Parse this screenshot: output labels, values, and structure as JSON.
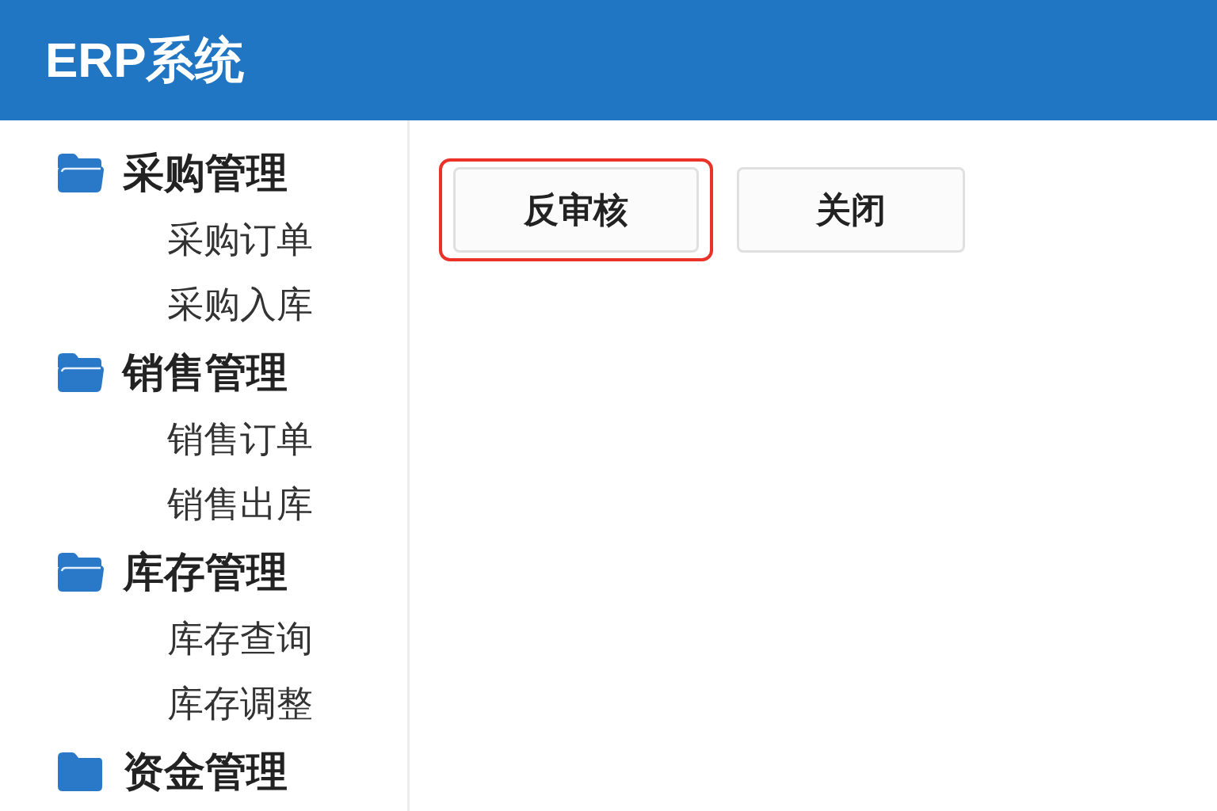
{
  "header": {
    "title": "ERP系统"
  },
  "sidebar": {
    "items": [
      {
        "label": "采购管理",
        "expanded": true,
        "children": [
          {
            "label": "采购订单"
          },
          {
            "label": "采购入库"
          }
        ]
      },
      {
        "label": "销售管理",
        "expanded": true,
        "children": [
          {
            "label": "销售订单"
          },
          {
            "label": "销售出库"
          }
        ]
      },
      {
        "label": "库存管理",
        "expanded": true,
        "children": [
          {
            "label": "库存查询"
          },
          {
            "label": "库存调整"
          }
        ]
      },
      {
        "label": "资金管理",
        "expanded": false
      }
    ]
  },
  "toolbar": {
    "buttons": [
      {
        "label": "反审核",
        "highlighted": true
      },
      {
        "label": "关闭",
        "highlighted": false
      }
    ]
  }
}
